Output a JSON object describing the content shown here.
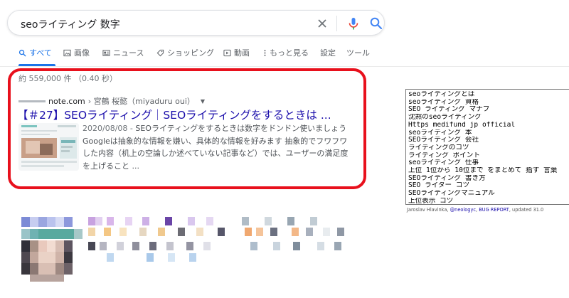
{
  "search": {
    "query": "seoライティング 数字"
  },
  "tabs": [
    {
      "label": "すべて",
      "icon": "search-icon",
      "active": true
    },
    {
      "label": "画像",
      "icon": "image-icon"
    },
    {
      "label": "ニュース",
      "icon": "news-icon"
    },
    {
      "label": "ショッピング",
      "icon": "tag-icon"
    },
    {
      "label": "動画",
      "icon": "video-icon"
    },
    {
      "label": "もっと見る",
      "icon": "more-vert-icon"
    },
    {
      "label": "設定"
    },
    {
      "label": "ツール"
    }
  ],
  "stats": "約 559,000 件 （0.40 秒）",
  "result": {
    "domain": "note.com",
    "breadcrumb": "› 宮鶴 桜懿（miyaduru oui）",
    "title": "【＃27】SEOライティング｜SEOライティングをするときは ...",
    "date": "2020/08/08 - ",
    "snippet_lines": [
      "SEOライティングをするときは数字をドンドン使いましょう",
      "Googleは抽象的な情報を嫌い、具体的な情報を好みます 抽象的でフワフワ",
      "した内容（机上の空論しか述べていない記事など）では、ユーザーの満足度",
      "を上げること ..."
    ]
  },
  "suggestions": [
    "seoライティングとは",
    "seoライティング 資格",
    "SEO ライティング マナブ",
    "沈黙のseoライティング",
    "Https medifund jp official",
    "seoライティング 本",
    "SEOライティング 会社",
    "ライティングのコツ",
    "ライティング ポイント",
    "seoライティング 仕事",
    "上位 1位から 10位まで をまとめて 指す 言葉",
    "SEOライティング 書き方",
    "SEO ライター コツ",
    "SEOライティングマニュアル",
    "上位表示 コツ"
  ],
  "credit": {
    "prefix": "Jaroslav Hlavinka, ",
    "handle": "@neologyc",
    "sep": ", ",
    "bug": "BUG REPORT",
    "suffix": ", updated 31.0"
  },
  "colors": {
    "highlight": "#e8101c",
    "link": "#1a0dab",
    "accent": "#1a73e8"
  }
}
